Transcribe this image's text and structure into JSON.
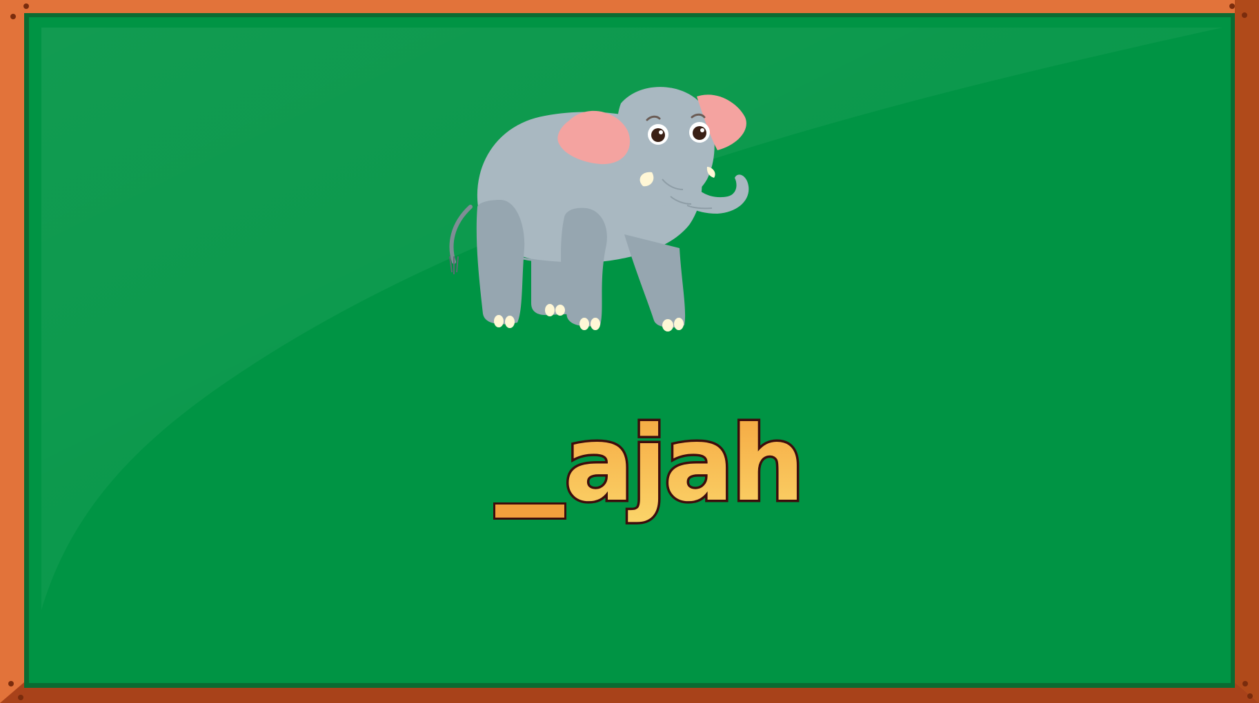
{
  "board": {
    "frame_color": "#e2733a",
    "frame_shadow_color": "#a8421a",
    "board_color": "#009444",
    "board_edge_color": "#0a6b32"
  },
  "puzzle": {
    "picture": "elephant",
    "blank_symbol": "_",
    "word_visible": "ajah",
    "text_fill_top": "#f5a640",
    "text_fill_bottom": "#fbd56a",
    "text_outline": "#3d0c0c"
  }
}
